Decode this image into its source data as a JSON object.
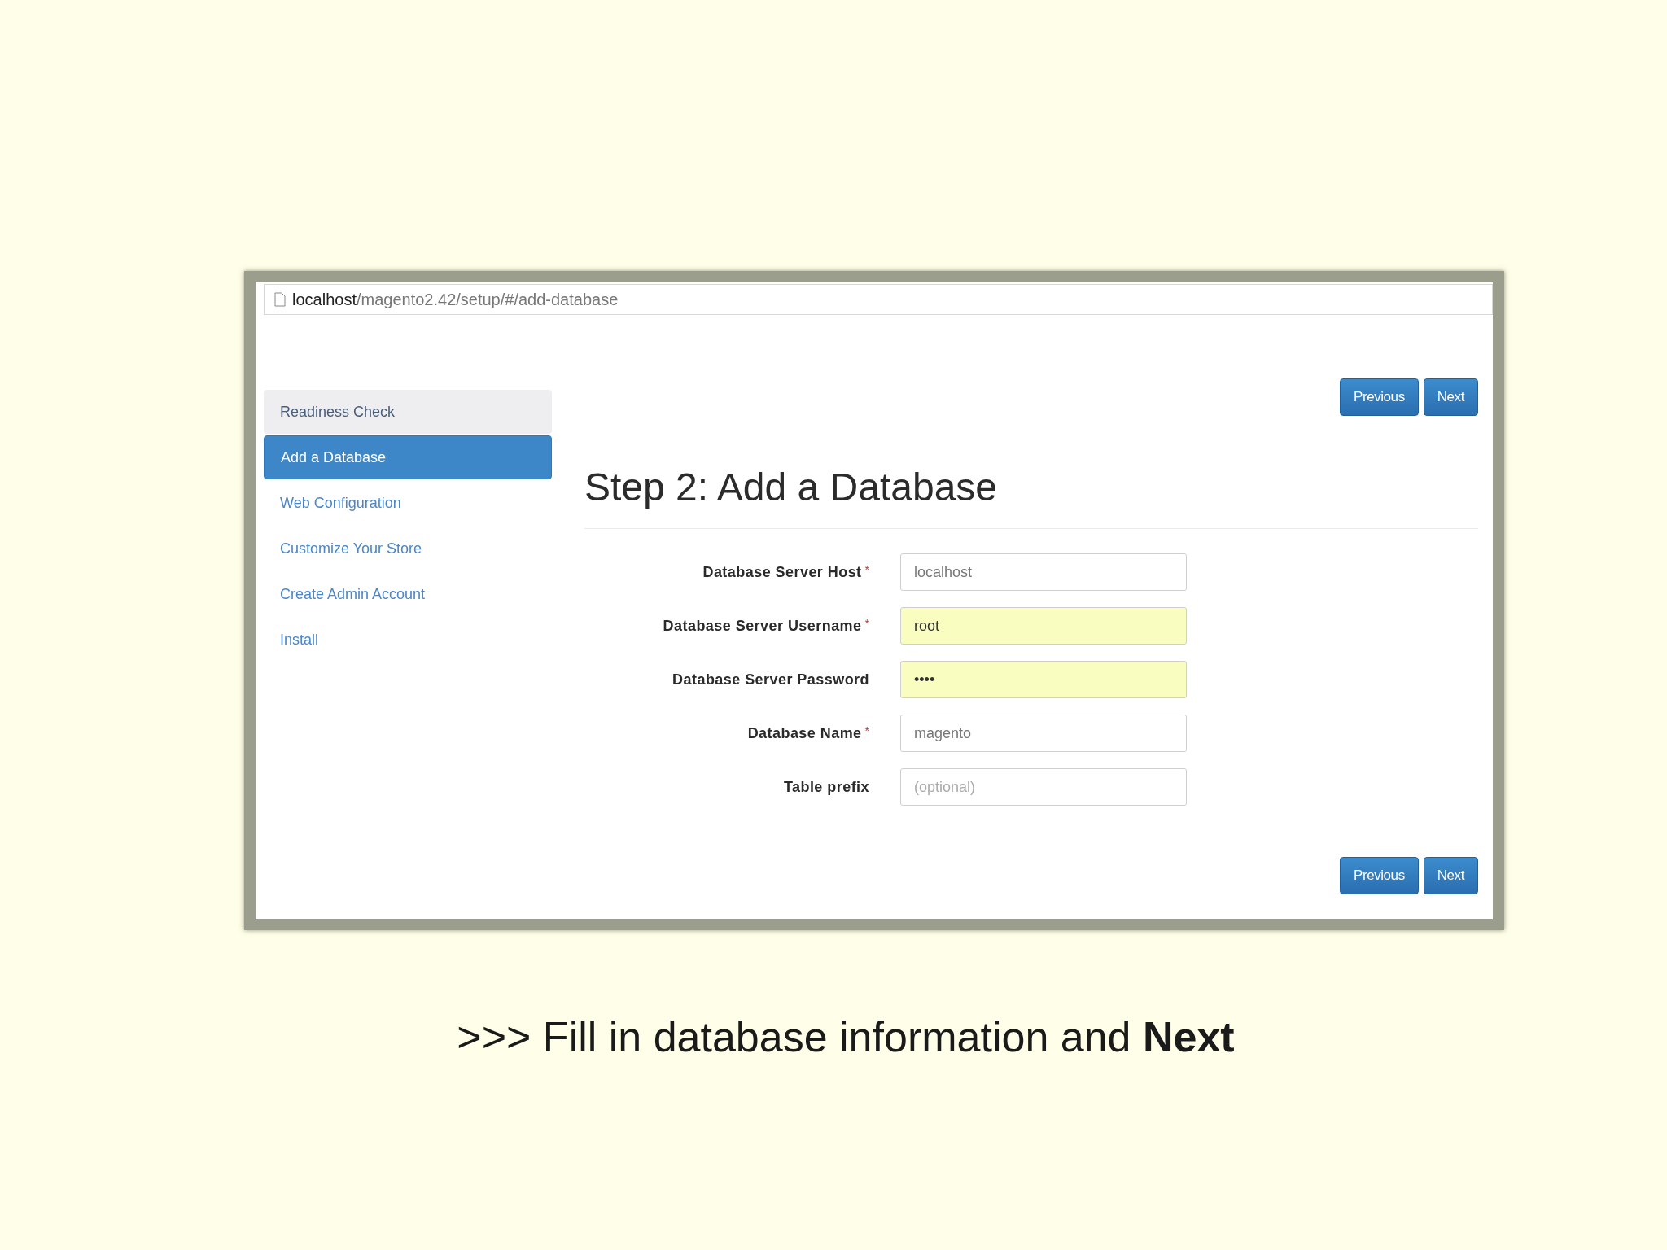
{
  "browser": {
    "url_host": "localhost",
    "url_path": "/magento2.42/setup/#/add-database"
  },
  "sidebar": {
    "items": [
      {
        "label": "Readiness Check",
        "completed": true,
        "selected": false
      },
      {
        "label": "Add a Database",
        "completed": false,
        "selected": true
      },
      {
        "label": "Web Configuration",
        "completed": false,
        "selected": false
      },
      {
        "label": "Customize Your Store",
        "completed": false,
        "selected": false
      },
      {
        "label": "Create Admin Account",
        "completed": false,
        "selected": false
      },
      {
        "label": "Install",
        "completed": false,
        "selected": false
      }
    ]
  },
  "top_buttons": [
    "Previous",
    "Next"
  ],
  "heading": "Step 2: Add a Database",
  "fields": [
    {
      "label": "Database Server Host",
      "required_mark": "*",
      "value": "localhost",
      "autofilled": false
    },
    {
      "label": "Database Server Username",
      "required_mark": "*",
      "value": "root",
      "autofilled": true
    },
    {
      "label": "Database Server Password",
      "value": "••••",
      "autofilled": true
    },
    {
      "label": "Database Name",
      "required_mark": "*",
      "value": "magento",
      "autofilled": false
    },
    {
      "label": "Table prefix",
      "placeholder": "(optional)",
      "autofilled": false
    }
  ],
  "bottom_buttons": [
    "Previous",
    "Next"
  ],
  "caption": ">>> Fill in database information and **Next**"
}
